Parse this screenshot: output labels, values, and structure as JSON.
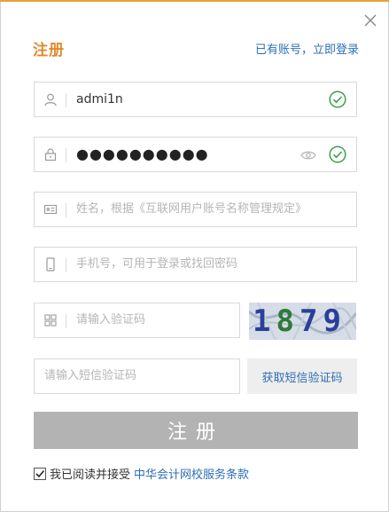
{
  "header": {
    "title": "注册",
    "login_link": "已有账号，立即登录"
  },
  "form": {
    "username": {
      "value": "admi1n",
      "valid": true
    },
    "password": {
      "masked_value": "●●●●●●●●●●",
      "valid": true
    },
    "realname": {
      "placeholder": "姓名，根据《互联网用户账号名称管理规定》"
    },
    "phone": {
      "placeholder": "手机号，可用于登录或找回密码"
    },
    "captcha": {
      "placeholder": "请输入验证码",
      "image_text": "1879"
    },
    "sms_code": {
      "placeholder": "请输入短信验证码"
    },
    "sms_button": "获取短信验证码",
    "submit_label": "注册"
  },
  "agreement": {
    "checked": true,
    "text": "我已阅读并接受",
    "terms_link": "中华会计网校服务条款"
  },
  "colors": {
    "accent_orange": "#e08a2e",
    "link_blue": "#2c6fb7",
    "valid_green": "#3aa04a",
    "submit_gray": "#b3b3b3"
  }
}
